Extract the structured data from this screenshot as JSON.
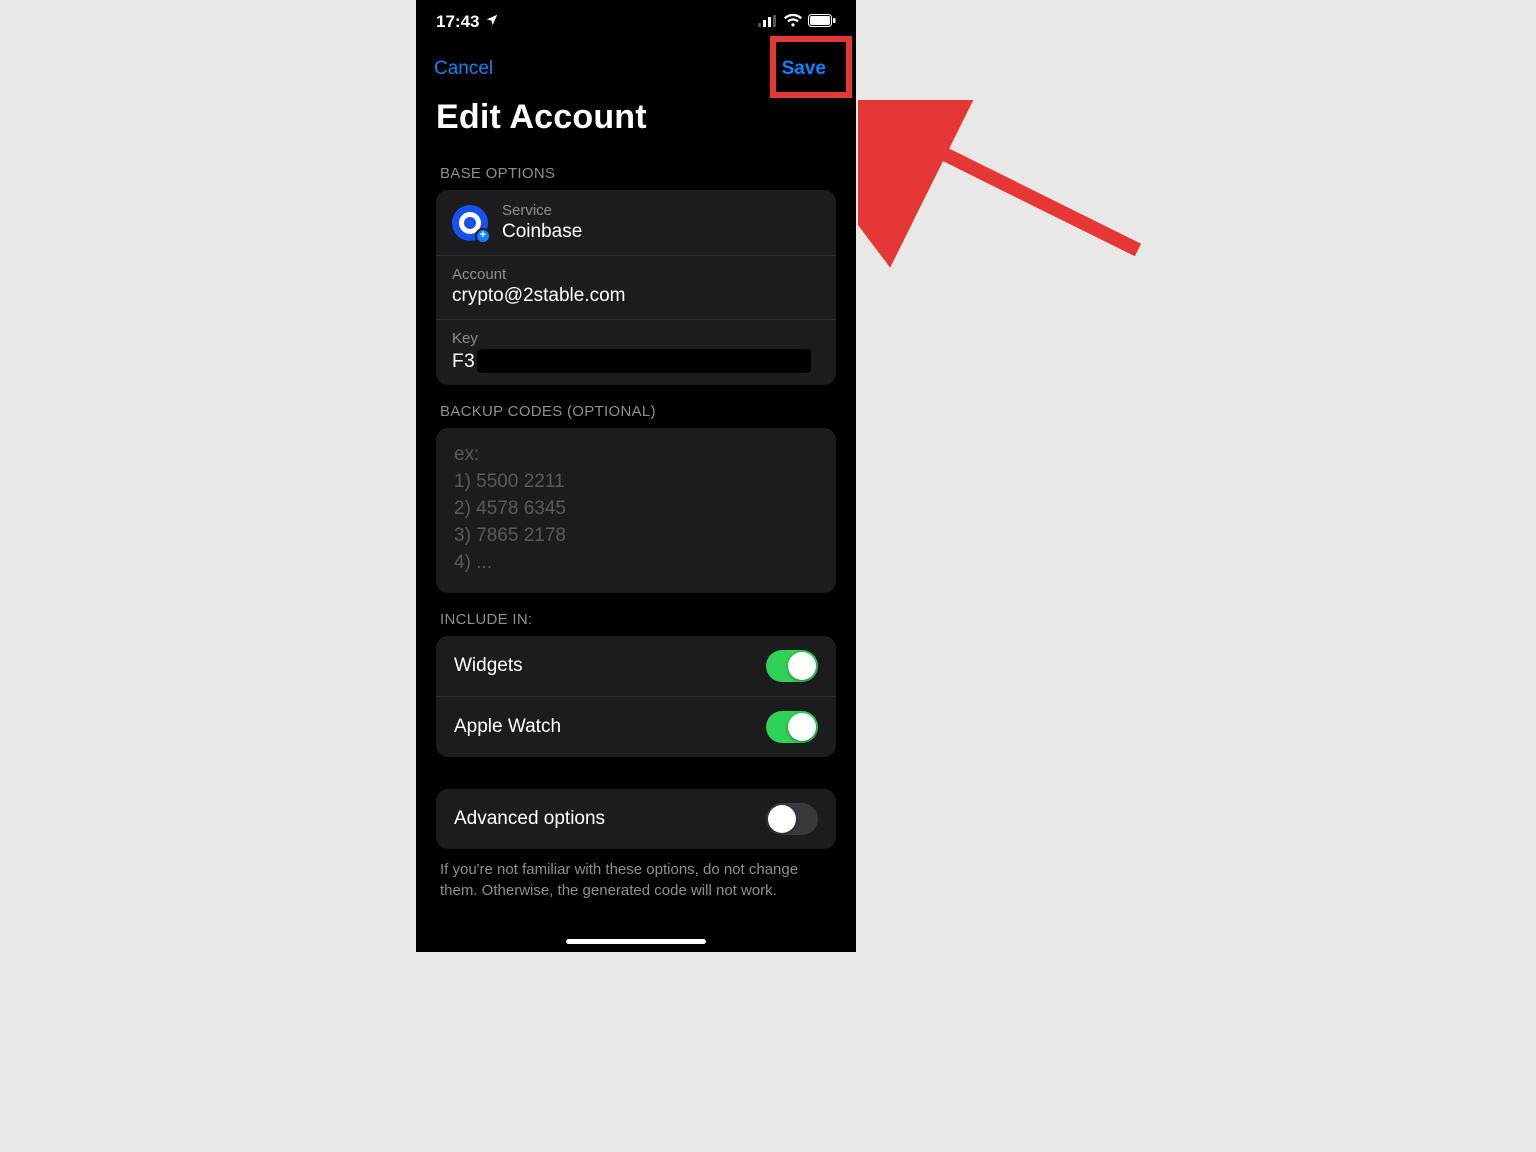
{
  "status": {
    "time": "17:43"
  },
  "nav": {
    "cancel": "Cancel",
    "save": "Save"
  },
  "title": "Edit Account",
  "sections": {
    "base_header": "BASE OPTIONS",
    "backup_header": "BACKUP CODES (OPTIONAL)",
    "include_header": "INCLUDE IN:"
  },
  "base": {
    "service_label": "Service",
    "service_value": "Coinbase",
    "account_label": "Account",
    "account_value": "crypto@2stable.com",
    "key_label": "Key",
    "key_prefix": "F3"
  },
  "backup_placeholder": "ex:\n1) 5500 2211\n2) 4578 6345\n3) 7865 2178\n4) ...",
  "include": {
    "widgets_label": "Widgets",
    "applewatch_label": "Apple Watch"
  },
  "advanced": {
    "label": "Advanced options",
    "footnote": "If you're not familiar with these options, do not change them. Otherwise, the generated code will not work."
  }
}
